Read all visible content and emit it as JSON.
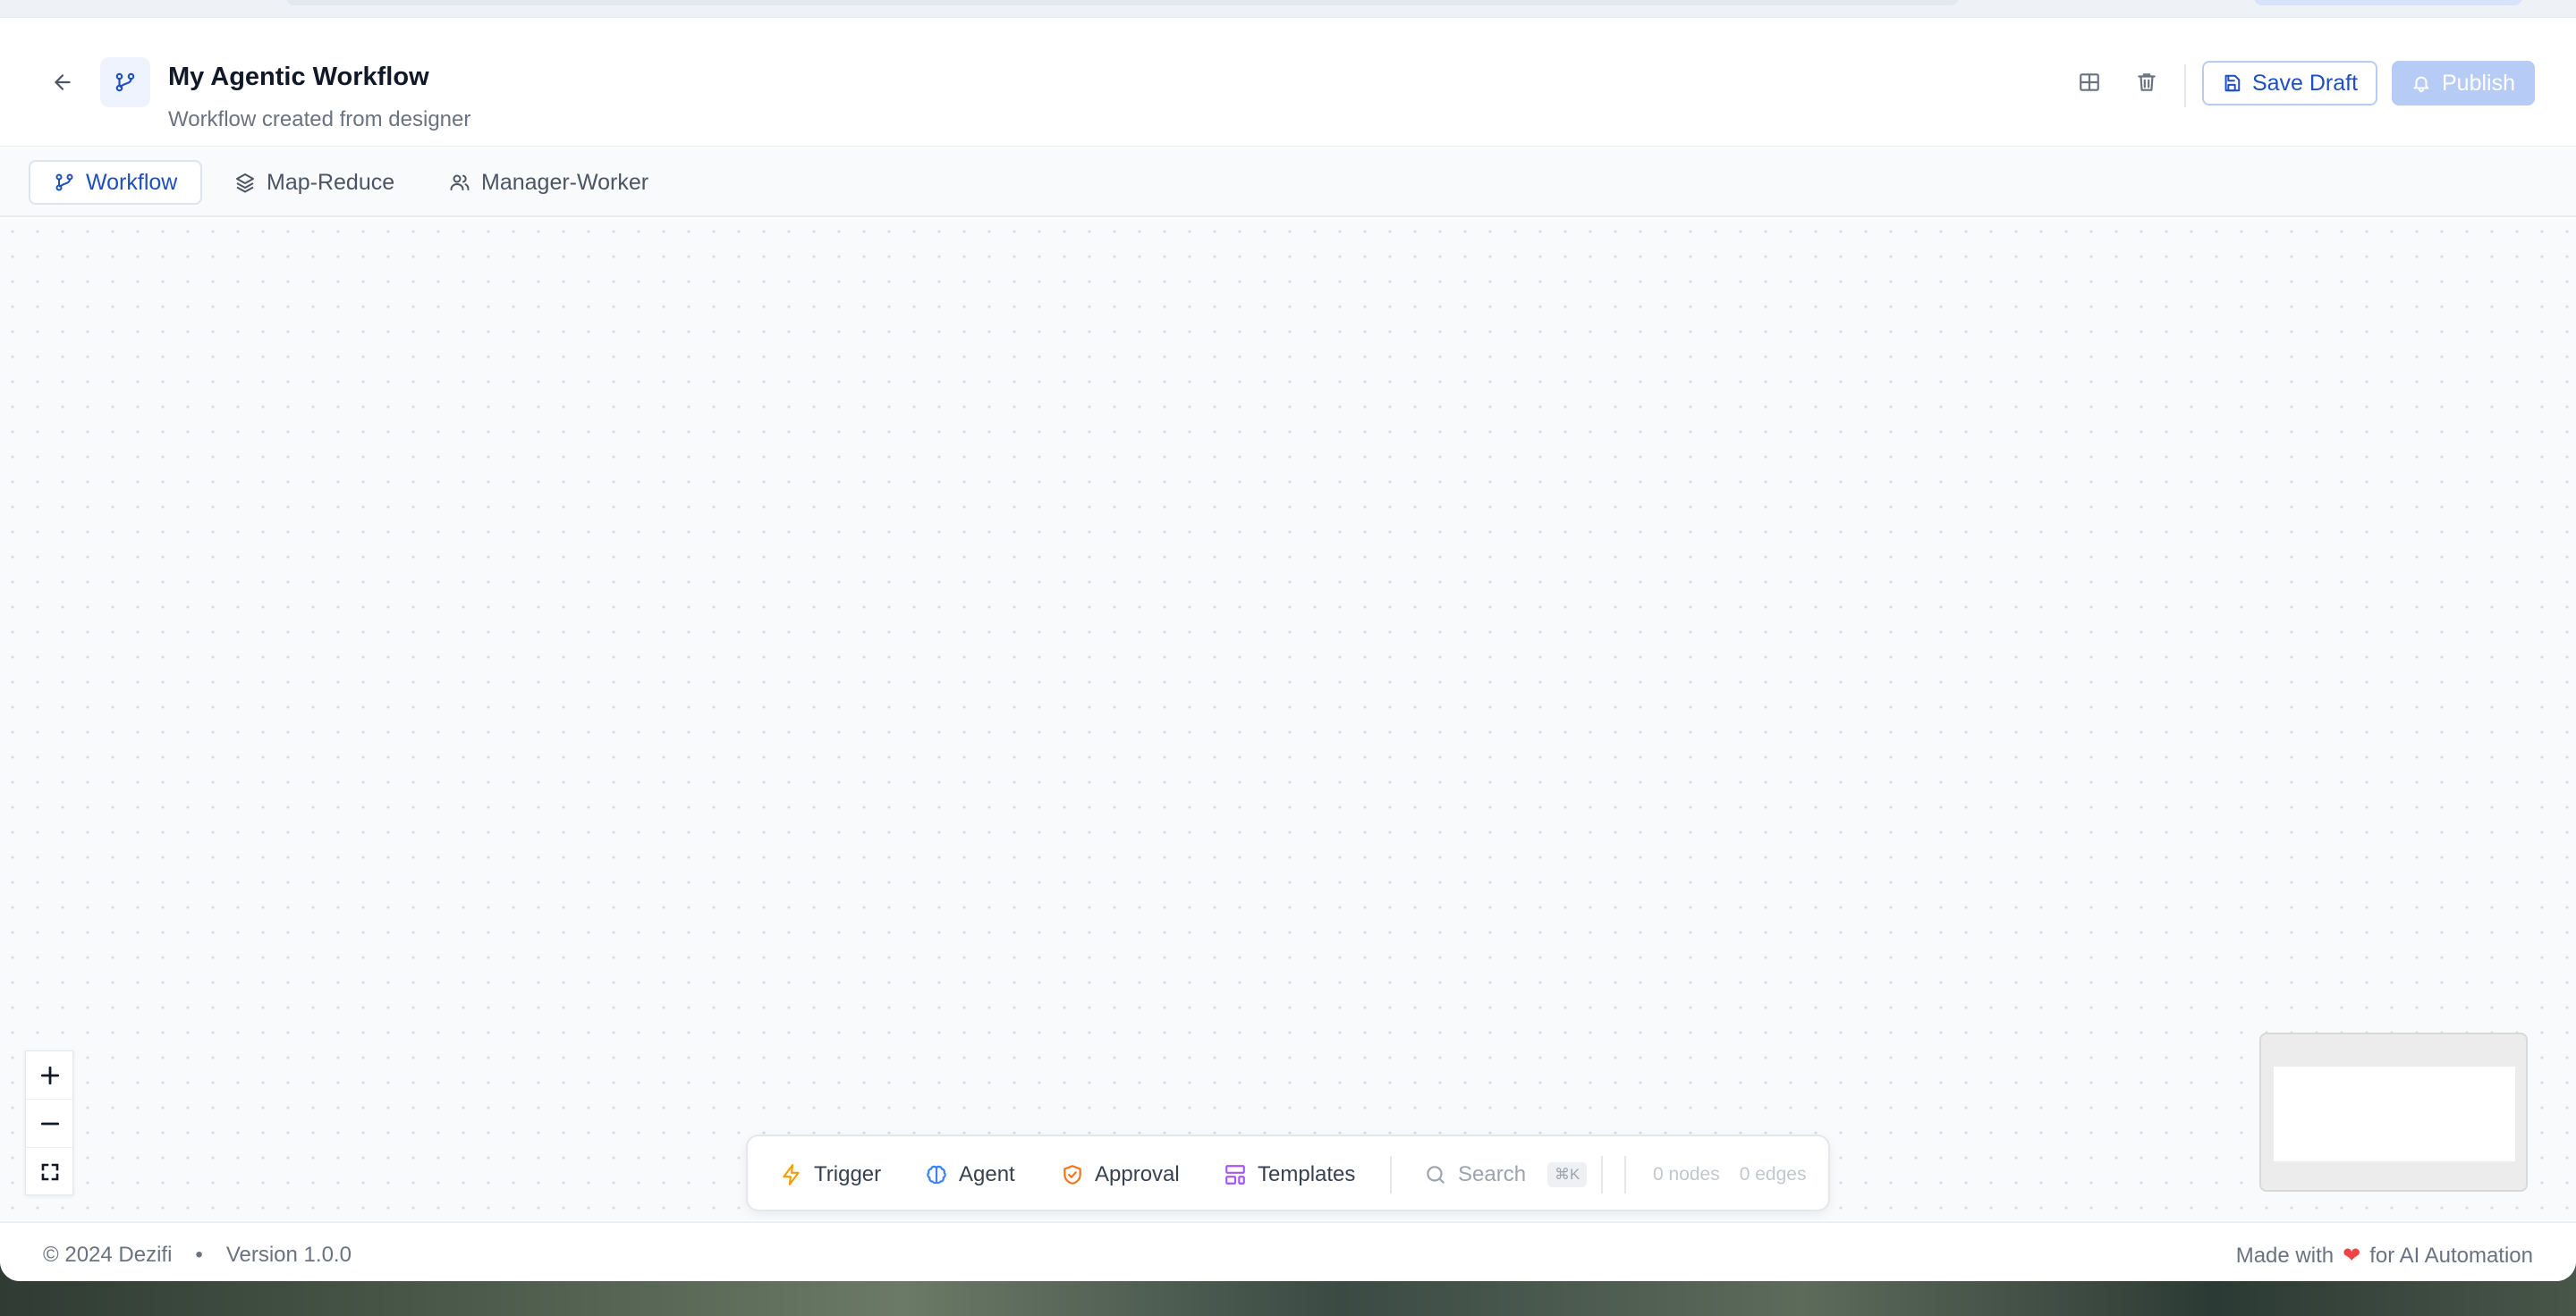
{
  "header": {
    "title": "My Agentic Workflow",
    "subtitle": "Workflow created from designer",
    "save_label": "Save Draft",
    "publish_label": "Publish"
  },
  "tabs": [
    {
      "label": "Workflow",
      "icon": "git-branch-icon",
      "active": true
    },
    {
      "label": "Map-Reduce",
      "icon": "layers-icon",
      "active": false
    },
    {
      "label": "Manager-Worker",
      "icon": "users-icon",
      "active": false
    }
  ],
  "toolbar": {
    "trigger": "Trigger",
    "agent": "Agent",
    "approval": "Approval",
    "templates": "Templates",
    "search": "Search",
    "shortcut": "⌘K",
    "nodes": "0 nodes",
    "edges": "0 edges"
  },
  "footer": {
    "copyright": "© 2024 Dezifi",
    "bullet": "•",
    "version": "Version 1.0.0",
    "made_with": "Made with",
    "heart": "❤",
    "for_text": "for AI Automation"
  },
  "colors": {
    "accent": "#1f4fbf",
    "publish_disabled": "#b6ccf7",
    "trigger": "#f59e0b",
    "agent": "#3b82f6",
    "approval": "#f97316",
    "templates": "#a855f7",
    "heart": "#ef4444"
  }
}
